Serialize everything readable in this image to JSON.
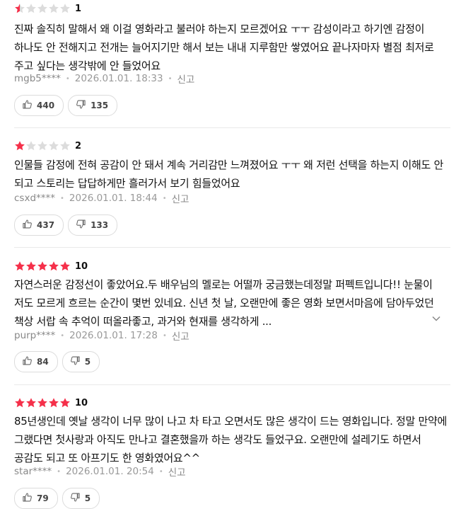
{
  "reviews": [
    {
      "stars_filled": 0.5,
      "score": "1",
      "text": "진짜 솔직히 말해서 왜 이걸 영화라고 불러야 하는지 모르겠어요 ㅜㅜ 감성이라고 하기엔 감정이 하나도 안 전해지고 전개는 늘어지기만 해서 보는 내내 지루함만 쌓였어요 끝나자마자 별점 최저로 주고 싶다는 생각밖에 안 들었어요",
      "author": "mgb5****",
      "date": "2026.01.01. 18:33",
      "report": "신고",
      "likes": "440",
      "dislikes": "135",
      "truncated": false
    },
    {
      "stars_filled": 1,
      "score": "2",
      "text": "인물들 감정에 전혀 공감이 안 돼서 계속 거리감만 느껴졌어요 ㅜㅜ 왜 저런 선택을 하는지 이해도 안 되고 스토리는 답답하게만 흘러가서 보기 힘들었어요",
      "author": "csxd****",
      "date": "2026.01.01. 18:44",
      "report": "신고",
      "likes": "437",
      "dislikes": "133",
      "truncated": false
    },
    {
      "stars_filled": 5,
      "score": "10",
      "text": "자연스러운 감정선이 좋았어요.두 배우님의 멜로는 어떨까 궁금했는데정말 퍼펙트입니다!! 눈물이 저도 모르게 흐르는 순간이 몇번 있네요. 신년 첫 날, 오랜만에 좋은 영화 보면서마음에 담아두었던 책상 서랍 속 추억이 떠올라좋고, 과거와 현재를 생각하게 ...",
      "author": "purp****",
      "date": "2026.01.01. 17:28",
      "report": "신고",
      "likes": "84",
      "dislikes": "5",
      "truncated": true
    },
    {
      "stars_filled": 5,
      "score": "10",
      "text": "85년생인데 옛날 생각이 너무 많이 나고 차 타고 오면서도 많은 생각이 드는 영화입니다. 정말 만약에 그랬다면 첫사랑과 아직도 만나고 결혼했을까 하는 생각도 들었구요. 오랜만에 설레기도 하면서 공감도 되고 또 아프기도 한 영화였어요^^",
      "author": "star****",
      "date": "2026.01.01. 20:54",
      "report": "신고",
      "likes": "79",
      "dislikes": "5",
      "truncated": false
    }
  ],
  "colors": {
    "star_on": "#f5304a",
    "star_off": "#dcdcdc"
  }
}
